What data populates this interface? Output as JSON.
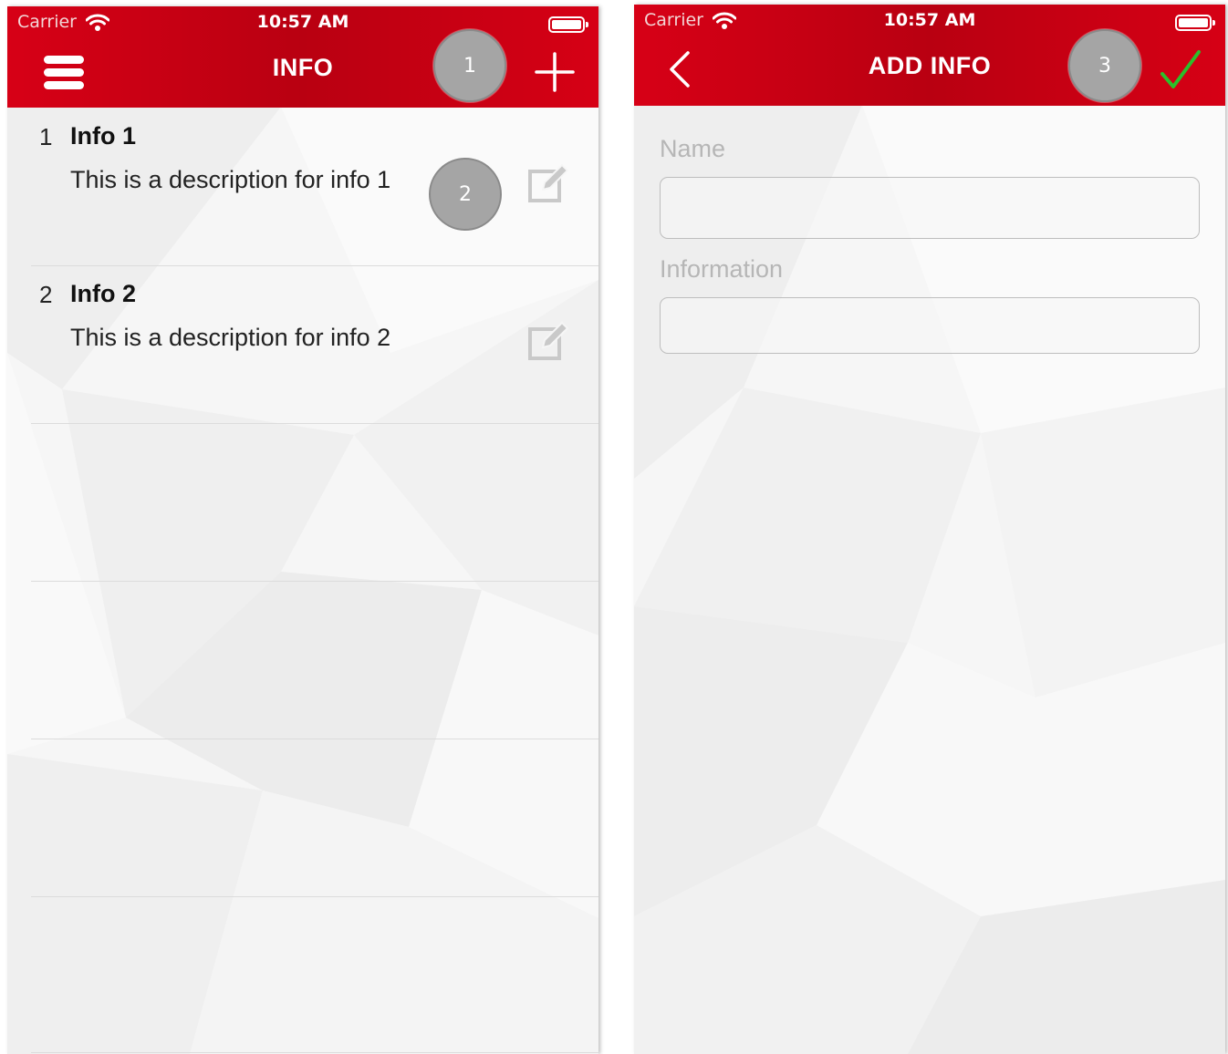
{
  "left_screen": {
    "status": {
      "carrier": "Carrier",
      "time": "10:57 AM"
    },
    "nav_title": "INFO",
    "callout_add": "1",
    "callout_edit": "2",
    "items": [
      {
        "index": "1",
        "title": "Info 1",
        "description": "This is a description for info 1"
      },
      {
        "index": "2",
        "title": "Info 2",
        "description": "This is a description for info 2"
      }
    ],
    "icons": [
      "hamburger-menu-icon",
      "plus-icon",
      "edit-icon",
      "wifi-icon",
      "battery-icon"
    ]
  },
  "right_screen": {
    "status": {
      "carrier": "Carrier",
      "time": "10:57 AM"
    },
    "nav_title": "ADD INFO",
    "callout_save": "3",
    "form": {
      "name_label": "Name",
      "name_value": "",
      "information_label": "Information",
      "information_value": ""
    },
    "icons": [
      "back-chevron-icon",
      "checkmark-icon",
      "wifi-icon",
      "battery-icon"
    ]
  },
  "colors": {
    "header_red": "#c8000f",
    "check_green": "#2bbf2b",
    "callout_gray": "#a5a5a5"
  }
}
